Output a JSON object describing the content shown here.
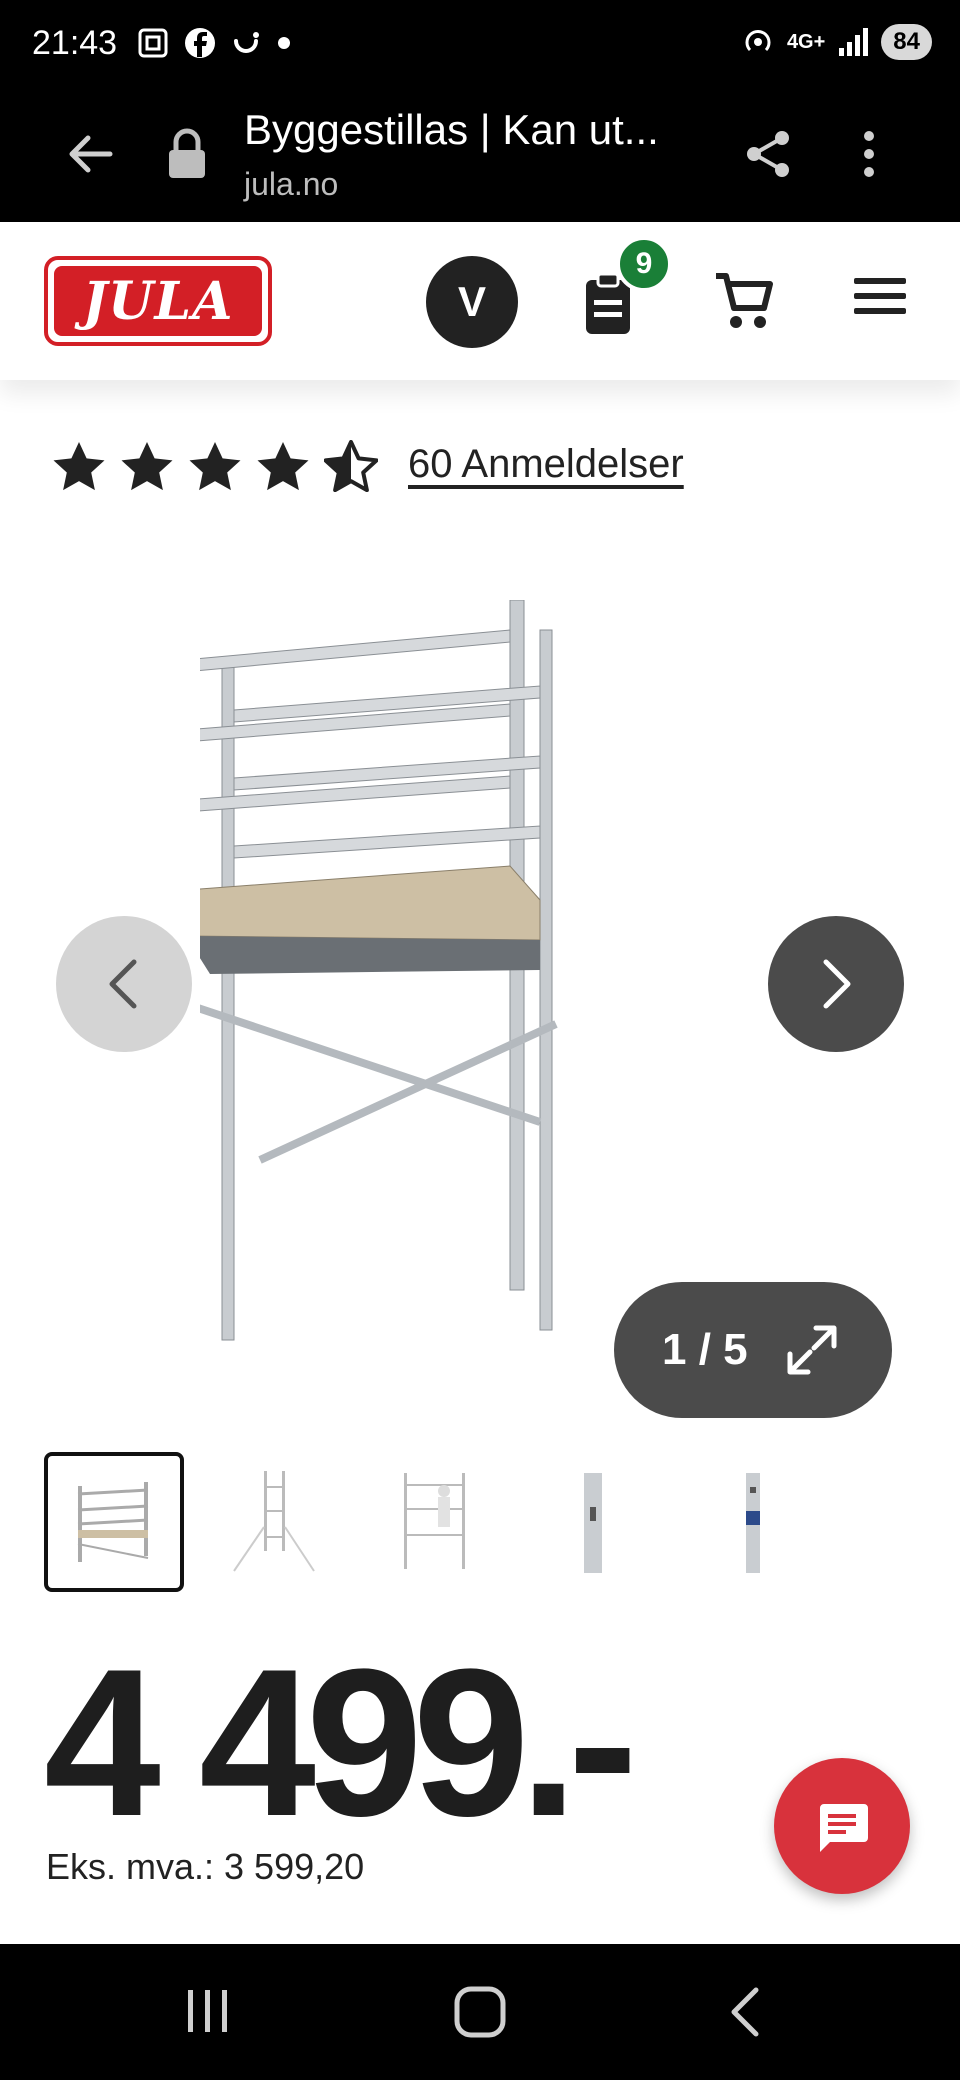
{
  "status_bar": {
    "time": "21:43",
    "network": "4G+",
    "battery": "84",
    "icons": [
      "screenshot-icon",
      "facebook-icon",
      "smile-icon",
      "dot-icon",
      "hotspot-icon",
      "signal-icon"
    ]
  },
  "browser": {
    "title": "Byggestillas | Kan ut...",
    "url": "jula.no"
  },
  "site_header": {
    "logo_text": "JULA",
    "avatar_letter": "V",
    "list_badge_count": "9",
    "brand_color": "#d31f26",
    "badge_color": "#1a7f37"
  },
  "rating": {
    "stars": 4.5,
    "reviews_label": "60 Anmeldelser"
  },
  "gallery": {
    "counter": "1 / 5",
    "current_index": 1,
    "total": 5
  },
  "thumbnails": [
    {
      "name": "scaffold-front"
    },
    {
      "name": "scaffold-tower"
    },
    {
      "name": "scaffold-with-person"
    },
    {
      "name": "scaffold-tube-detail"
    },
    {
      "name": "scaffold-tube-label"
    }
  ],
  "price": {
    "main": "4 499.-",
    "ex_vat": "Eks. mva.: 3 599,20"
  }
}
